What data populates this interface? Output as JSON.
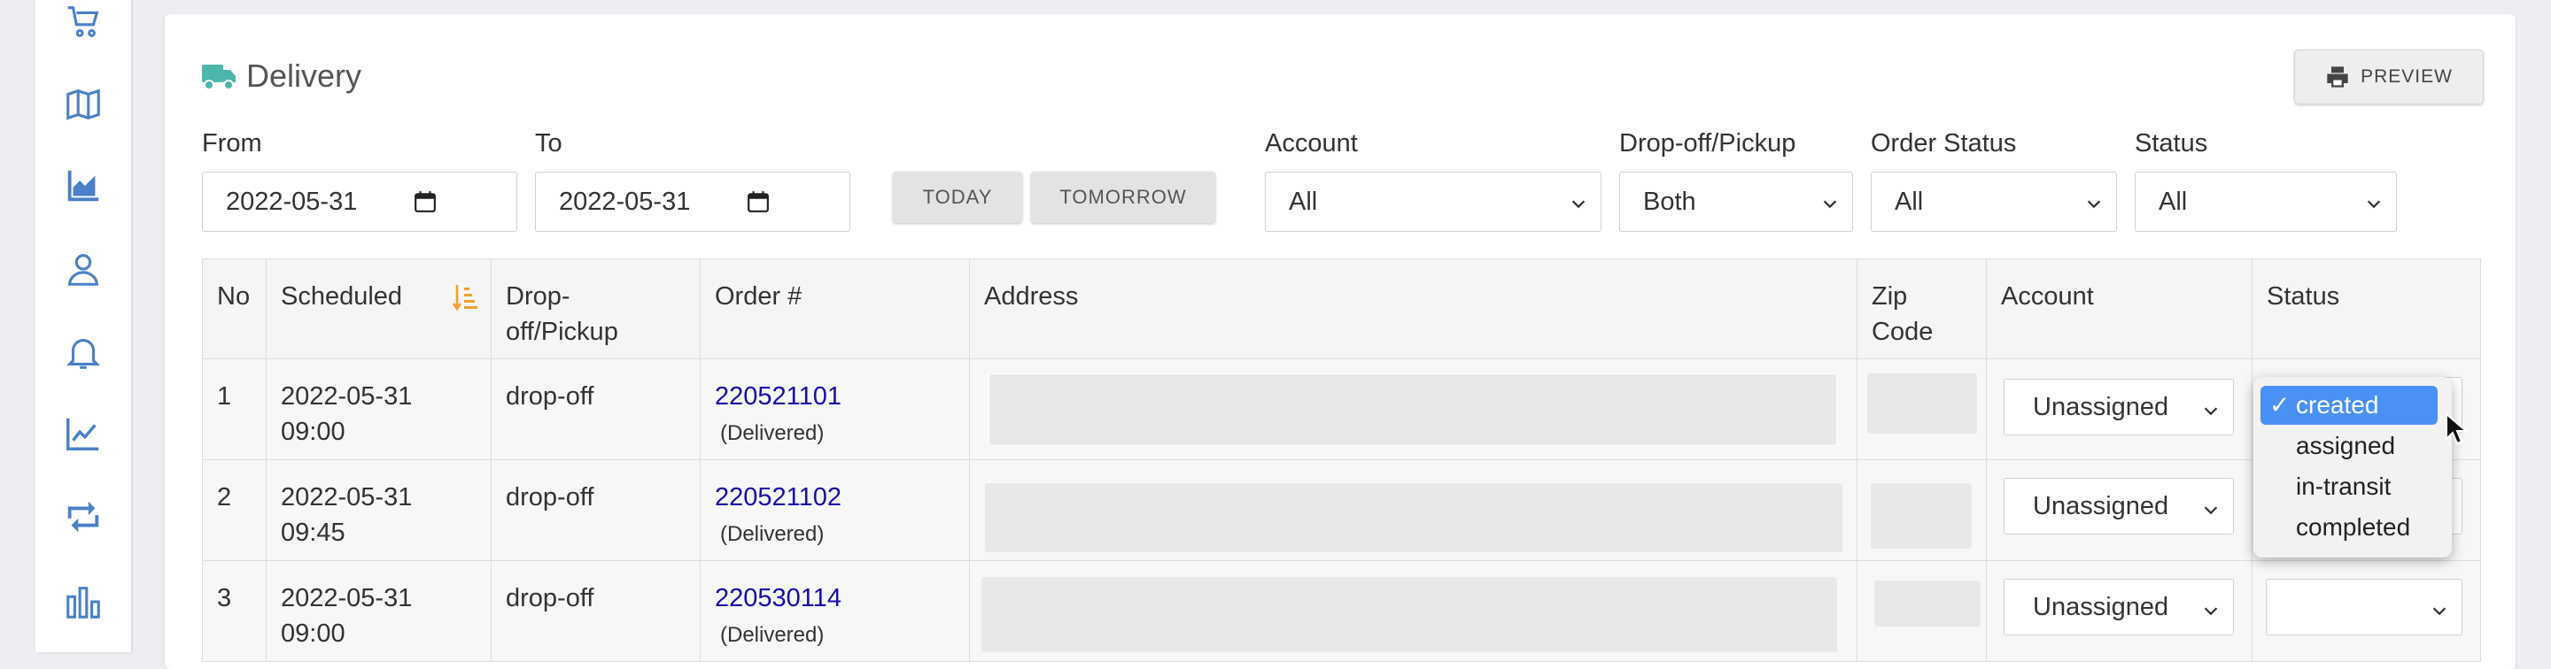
{
  "sidebar": {
    "icons": [
      "cart-icon",
      "map-icon",
      "area-chart-icon",
      "user-icon",
      "bell-icon",
      "line-chart-icon",
      "retweet-icon",
      "bar-chart-icon"
    ]
  },
  "header": {
    "title": "Delivery",
    "title_icon": "truck-icon",
    "preview_label": "PREVIEW"
  },
  "filters": {
    "from_label": "From",
    "from_value": "2022-05-31",
    "to_label": "To",
    "to_value": "2022-05-31",
    "today_label": "TODAY",
    "tomorrow_label": "TOMORROW",
    "account_label": "Account",
    "account_value": "All",
    "dropoff_label": "Drop-off/Pickup",
    "dropoff_value": "Both",
    "order_status_label": "Order Status",
    "order_status_value": "All",
    "status_label": "Status",
    "status_value": "All"
  },
  "table": {
    "headers": {
      "no": "No",
      "scheduled": "Scheduled",
      "dropoff_1": "Drop-",
      "dropoff_2": "off/Pickup",
      "order": "Order #",
      "address": "Address",
      "zip_1": "Zip",
      "zip_2": "Code",
      "account": "Account",
      "status": "Status"
    },
    "rows": [
      {
        "no": "1",
        "date": "2022-05-31",
        "time": "09:00",
        "type": "drop-off",
        "order": "220521101",
        "order_status": "(Delivered)",
        "account": "Unassigned"
      },
      {
        "no": "2",
        "date": "2022-05-31",
        "time": "09:45",
        "type": "drop-off",
        "order": "220521102",
        "order_status": "(Delivered)",
        "account": "Unassigned"
      },
      {
        "no": "3",
        "date": "2022-05-31",
        "time": "09:00",
        "type": "drop-off",
        "order": "220530114",
        "order_status": "(Delivered)",
        "account": "Unassigned"
      }
    ]
  },
  "status_dropdown": {
    "options": [
      "created",
      "assigned",
      "in-transit",
      "completed"
    ],
    "selected": "created",
    "check": "✓"
  },
  "colors": {
    "accent_teal": "#4db6ac",
    "sidebar_icon_blue": "#4a80c8",
    "sort_orange": "#f0a030",
    "link_blue": "#1a0dab",
    "dropdown_selected": "#4a90f5"
  }
}
